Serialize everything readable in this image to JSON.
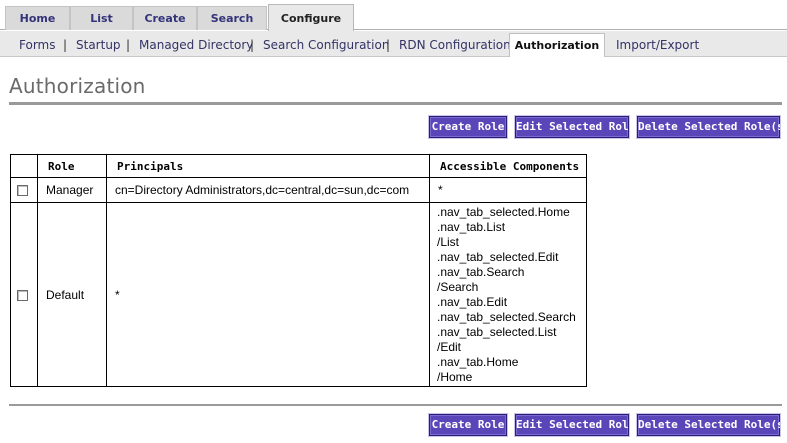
{
  "tabs": [
    {
      "label": "Home"
    },
    {
      "label": "List"
    },
    {
      "label": "Create"
    },
    {
      "label": "Search"
    },
    {
      "label": "Configure",
      "active": true
    }
  ],
  "subnav": [
    {
      "label": "Forms"
    },
    {
      "label": "Startup"
    },
    {
      "label": "Managed Directory"
    },
    {
      "label": "Search Configuration"
    },
    {
      "label": "RDN Configuration"
    },
    {
      "label": "Authorization",
      "active": true
    },
    {
      "label": "Import/Export"
    }
  ],
  "page_title": "Authorization",
  "buttons": {
    "create_role": "Create Role",
    "edit_selected_role": "Edit Selected Role",
    "delete_selected_roles": "Delete Selected Role(s)"
  },
  "table": {
    "headers": [
      "",
      "Role",
      "Principals",
      "Accessible Components"
    ],
    "rows": [
      {
        "checked": false,
        "role": "Manager",
        "principals": "cn=Directory Administrators,dc=central,dc=sun,dc=com",
        "components": [
          "*"
        ]
      },
      {
        "checked": false,
        "role": "Default",
        "principals": "*",
        "components": [
          ".nav_tab_selected.Home",
          ".nav_tab.List",
          "/List",
          ".nav_tab_selected.Edit",
          ".nav_tab.Search",
          "/Search",
          ".nav_tab.Edit",
          ".nav_tab_selected.Search",
          ".nav_tab_selected.List",
          "/Edit",
          ".nav_tab.Home",
          "/Home"
        ]
      }
    ]
  },
  "colors": {
    "button_bg": "#5a46b8",
    "link": "#333366",
    "title": "#6a6a6a",
    "subnav_bg": "#e9e9e9"
  }
}
